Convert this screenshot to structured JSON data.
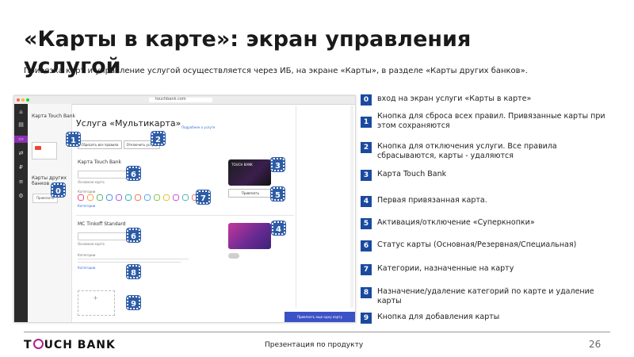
{
  "title": "«Карты в карте»: экран управления услугой",
  "subtitle": "Привязка карт и управление услугой осуществляется через ИБ, на экране «Карты», в разделе «Карты других банков».",
  "screenshot": {
    "url_text": "touchbank.com",
    "sidebar_card_title": "Карта Touch Bank",
    "other_banks_label": "Карты других банков",
    "add_button": "Привязать",
    "service_title": "Услуга «Мультикарта»",
    "service_link": "Подробнее о услуге",
    "reset_button": "Сбросить все правила",
    "disable_button": "Отключить услугу",
    "card1_section": "Карта Touch Bank",
    "card2_section": "MC Tinkoff Standard",
    "categories_label": "Категории",
    "status_label": "Основная карта",
    "touch_card_label": "TOUCH BANK",
    "bottom_button": "Привязать еще одну карту",
    "attach_label": "Привязать"
  },
  "markers": [
    "0",
    "1",
    "2",
    "3",
    "4",
    "5",
    "6",
    "7",
    "8",
    "9"
  ],
  "legend": [
    {
      "num": "0",
      "text": "вход на экран услуги «Карты в карте»"
    },
    {
      "num": "1",
      "text": "Кнопка для сброса всех правил. Привязанные карты при этом сохраняются"
    },
    {
      "num": "2",
      "text": "Кнопка для отключения услуги. Все правила сбрасываются, карты - удаляются"
    },
    {
      "num": "3",
      "text": "Карта Touch Bank"
    },
    {
      "num": "4",
      "text": "Первая привязанная карта."
    },
    {
      "num": "5",
      "text": "Активация/отключение «Суперкнопки»"
    },
    {
      "num": "6",
      "text": "Статус карты (Основная/Резервная/Специальная)"
    },
    {
      "num": "7",
      "text": "Категории, назначенные на карту"
    },
    {
      "num": "8",
      "text": "Назначение/удаление категорий по карте и удаление карты"
    },
    {
      "num": "9",
      "text": "Кнопка для добавления карты"
    }
  ],
  "footer": {
    "logo_left": "T",
    "logo_right": "UCH BANK",
    "center": "Презентация по продукту",
    "page": "26"
  },
  "colors": {
    "marker": "#2d5ca6",
    "legend_badge": "#1a4aa0",
    "brand_accent": "#b0208f"
  }
}
